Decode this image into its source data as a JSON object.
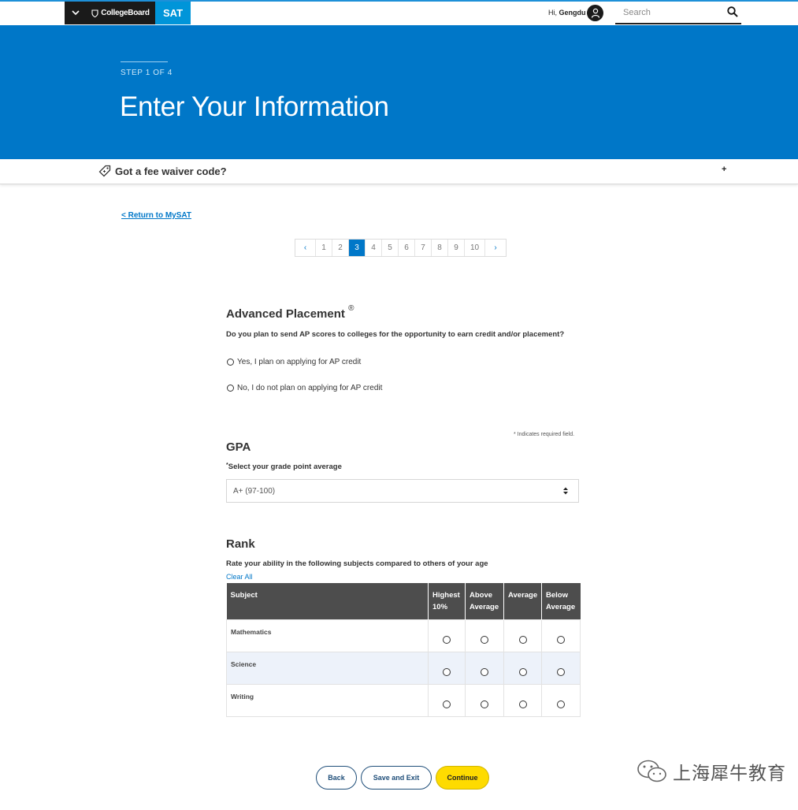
{
  "header": {
    "brand": "CollegeBoard",
    "product": "SAT",
    "greeting_prefix": "Hi,",
    "user_name": "Gengdu",
    "search_placeholder": "Search"
  },
  "hero": {
    "step": "STEP 1 OF 4",
    "title": "Enter Your Information"
  },
  "fee_waiver": {
    "label": "Got a fee waiver code?",
    "toggle": "+"
  },
  "return_link": "< Return to MySAT",
  "pagination": {
    "prev": "‹",
    "next": "›",
    "pages": [
      "1",
      "2",
      "3",
      "4",
      "5",
      "6",
      "7",
      "8",
      "9",
      "10"
    ],
    "current": "3"
  },
  "ap": {
    "title": "Advanced Placement",
    "reg_mark": "®",
    "question": "Do you plan to send AP scores to colleges for the opportunity to earn credit and/or placement?",
    "options": [
      "Yes, I plan on applying for AP credit",
      "No, I do not plan on applying for AP credit"
    ]
  },
  "required_note": "* Indicates required field.",
  "gpa": {
    "title": "GPA",
    "asterisk": "*",
    "label": "Select your grade point average",
    "selected": "A+ (97-100)"
  },
  "rank": {
    "title": "Rank",
    "prompt": "Rate your ability in the following subjects compared to others of your age",
    "clear_all": "Clear All",
    "columns": [
      "Subject",
      "Highest 10%",
      "Above Average",
      "Average",
      "Below Average"
    ],
    "rows": [
      "Mathematics",
      "Science",
      "Writing"
    ]
  },
  "buttons": {
    "back": "Back",
    "save_exit": "Save and Exit",
    "continue": "Continue"
  },
  "watermark": "上海犀牛教育",
  "colors": {
    "brand_blue": "#0077c8",
    "sat_blue": "#0095d9",
    "continue_yellow": "#fedb00",
    "table_header": "#4d4d4d"
  }
}
